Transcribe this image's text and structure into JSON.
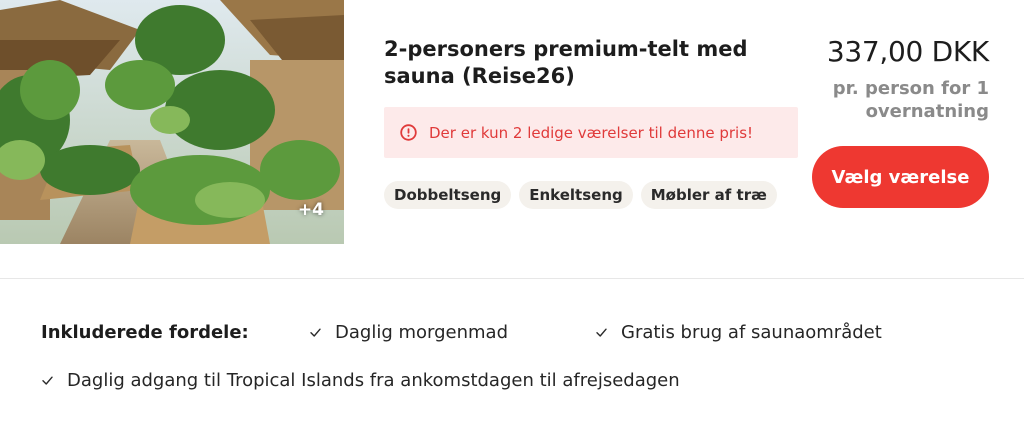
{
  "photo": {
    "more_count": "+4"
  },
  "room": {
    "title": "2-personers premium-telt med sauna (Reise26)",
    "alert": "Der er kun 2 ledige værelser til denne pris!",
    "tags": [
      "Dobbeltseng",
      "Enkeltseng",
      "Møbler af træ"
    ]
  },
  "pricing": {
    "price": "337,00 DKK",
    "unit": "pr. person for 1 overnatning",
    "cta": "Vælg værelse"
  },
  "benefits": {
    "label": "Inkluderede fordele:",
    "items": [
      "Daglig morgenmad",
      "Gratis brug af saunaområdet",
      "Daglig adgang til Tropical Islands fra ankomstdagen til afrejsedagen"
    ]
  },
  "colors": {
    "accent": "#ee3831",
    "alert_bg": "#fdeaea",
    "alert_text": "#e03a3a",
    "tag_bg": "#f4f1ec",
    "muted": "#8a8a8a"
  },
  "icons": {
    "alert": "alert-circle-icon",
    "check": "check-icon"
  }
}
